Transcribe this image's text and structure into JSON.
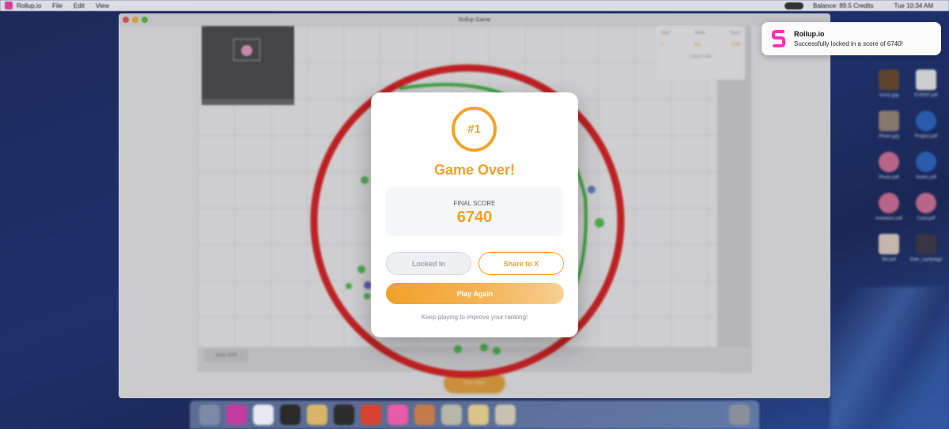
{
  "menubar": {
    "app_name": "Rollup.io",
    "menus": [
      "File",
      "Edit",
      "View"
    ],
    "status_items": [
      "Balance: 89.5 Credits",
      "Tue 10:34 AM"
    ]
  },
  "window": {
    "title": "Rollup Game"
  },
  "background_game": {
    "leaderboard": {
      "headers": [
        "Rank",
        "Name",
        "Score"
      ],
      "row": [
        "1",
        "You",
        "6740"
      ],
      "footer": "1 player alive"
    },
    "score_chip": "Score: 6740",
    "play_again_label": "Play Again"
  },
  "desktop_icons": [
    {
      "label": "Icon1.jpg"
    },
    {
      "label": "EVENT.pdf"
    },
    {
      "label": "Photo.jpg"
    },
    {
      "label": "Project.pdf"
    },
    {
      "label": "Photo.pdf"
    },
    {
      "label": "Notes.pdf"
    },
    {
      "label": "Invitation.pdf"
    },
    {
      "label": "Card.pdf"
    },
    {
      "label": "Bill.pdf"
    },
    {
      "label": "Sale_campaign"
    }
  ],
  "notification": {
    "app": "Rollup.io",
    "message": "Successfully locked in a score of 6740!"
  },
  "modal": {
    "rank": "#1",
    "title": "Game Over!",
    "score_label": "FINAL SCORE",
    "score_value": "6740",
    "locked_label": "Locked In",
    "share_label": "Share to X",
    "play_again_label": "Play Again",
    "hint": "Keep playing to improve your ranking!"
  },
  "colors": {
    "accent": "#F0A32A",
    "ring_red": "#E02020",
    "ring_green": "#3DBB3D"
  }
}
